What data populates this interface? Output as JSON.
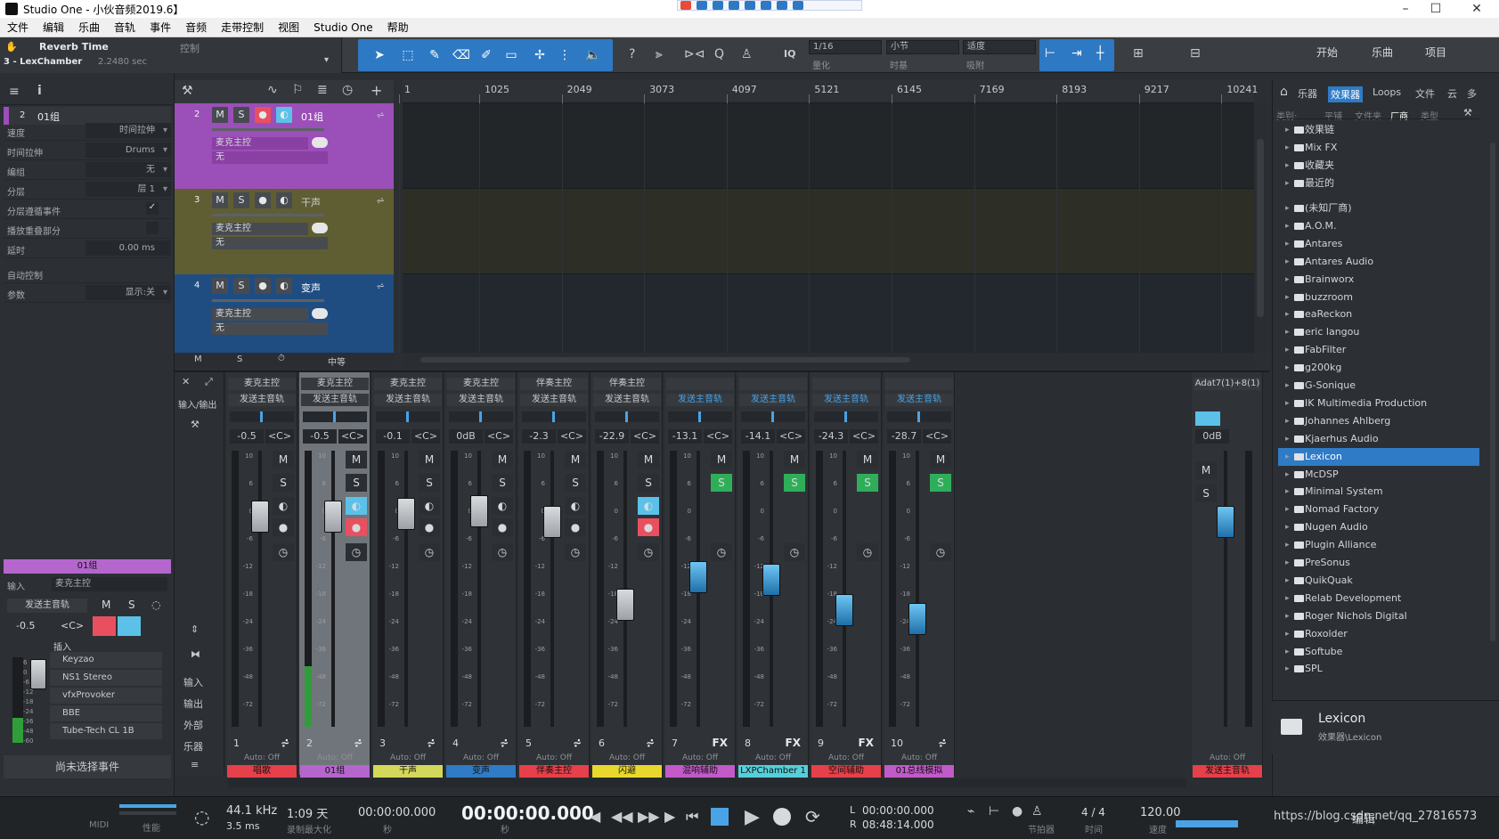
{
  "window": {
    "title": "Studio One - 小伙音频2019.6】"
  },
  "menu": [
    "文件",
    "编辑",
    "乐曲",
    "音轨",
    "事件",
    "音频",
    "走带控制",
    "视图",
    "Studio One",
    "帮助"
  ],
  "toolbar": {
    "plugin_name": "Reverb Time",
    "plugin_ctrl": "控制",
    "track_label": "3 - LexChamber",
    "plugin_value": "2.2480 sec",
    "quantize": {
      "value": "1/16",
      "label": "量化"
    },
    "timebase": {
      "value": "小节",
      "label": "时基"
    },
    "snap": {
      "value": "适度",
      "label": "吸附"
    },
    "iq": "IQ",
    "views": [
      "开始",
      "乐曲",
      "项目"
    ]
  },
  "inspector": {
    "track_num": "2",
    "track_name": "01组",
    "rows": [
      {
        "k": "速度",
        "v": "时间拉伸"
      },
      {
        "k": "时间拉伸",
        "v": "Drums"
      },
      {
        "k": "编组",
        "v": "无"
      },
      {
        "k": "分层",
        "v": "层 1"
      },
      {
        "k": "分层遵循事件",
        "v": "✓"
      },
      {
        "k": "播放重叠部分",
        "v": ""
      },
      {
        "k": "延时",
        "v": "0.00 ms"
      },
      {
        "k": "自动控制",
        "v": ""
      },
      {
        "k": "参数",
        "v": "显示:关"
      }
    ],
    "strip": {
      "name": "01组",
      "input_label": "输入",
      "input_value": "麦克主控",
      "send": "发送主音轨",
      "gain": "-0.5",
      "pan": "<C>",
      "insert_label": "插入",
      "inserts": [
        "Keyzao",
        "NS1 Stereo",
        "vfxProvoker",
        "BBE",
        "Tube-Tech CL 1B"
      ],
      "no_event": "尚未选择事件"
    },
    "scale": [
      "6",
      "0",
      "-6",
      "-12",
      "-18",
      "-24",
      "-36",
      "-48",
      "-60"
    ]
  },
  "tracks": [
    {
      "num": "2",
      "name": "01组",
      "color": "#9b4fb8",
      "laneColor": "#232629",
      "input": "麦克主控",
      "output": "无"
    },
    {
      "num": "3",
      "name": "干声",
      "color": "#5f5e33",
      "laneColor": "#2d2e25",
      "input": "麦克主控",
      "output": "无"
    },
    {
      "num": "4",
      "name": "变声",
      "color": "#1f4d82",
      "laneColor": "#22282e",
      "input": "麦克主控",
      "output": "无"
    }
  ],
  "track_footer": {
    "m": "M",
    "s": "S",
    "mid": "中等"
  },
  "ruler": [
    "1",
    "1025",
    "2049",
    "3073",
    "4097",
    "5121",
    "6145",
    "7169",
    "8193",
    "9217",
    "10241"
  ],
  "browser": {
    "tabs": [
      "乐器",
      "效果器",
      "Loops",
      "文件",
      "云",
      "多"
    ],
    "subtabs": [
      "类别:",
      "平铺",
      "文件夹",
      "厂商",
      "类型"
    ],
    "top_items": [
      "效果链",
      "Mix FX",
      "收藏夹",
      "最近的"
    ],
    "vendors": [
      "(未知厂商)",
      "A.O.M.",
      "Antares",
      "Antares Audio",
      "Brainworx",
      "buzzroom",
      "eaReckon",
      "eric langou",
      "FabFilter",
      "g200kg",
      "G-Sonique",
      "IK Multimedia Production",
      "Johannes Ahlberg",
      "Kjaerhus Audio",
      "Lexicon",
      "McDSP",
      "Minimal System",
      "Nomad Factory",
      "Nugen Audio",
      "Plugin Alliance",
      "PreSonus",
      "QuikQuak",
      "Relab Development",
      "Roger Nichols Digital",
      "Roxolder",
      "Softube",
      "SPL"
    ],
    "selected": "Lexicon",
    "footer_title": "Lexicon",
    "footer_path": "效果器\\Lexicon"
  },
  "mixer": {
    "side": [
      "输入/输出",
      "输入",
      "输出",
      "外部",
      "乐器"
    ],
    "scale": [
      "10",
      "6",
      "0",
      "-6",
      "-12",
      "-18",
      "-24",
      "-36",
      "-48",
      "-72"
    ],
    "channels": [
      {
        "num": "1",
        "top": "麦克主控",
        "send": "发送主音轨",
        "gain": "-0.5",
        "pan": "<C>",
        "name": "唱歌",
        "labelColor": "#e6404a",
        "fader": 0.18,
        "auto": "Auto: Off",
        "fx": ""
      },
      {
        "num": "2",
        "top": "麦克主控",
        "send": "发送主音轨",
        "gain": "-0.5",
        "pan": "<C>",
        "name": "01组",
        "labelColor": "#b466cc",
        "fader": 0.18,
        "auto": "Auto: Off",
        "fx": "",
        "sel": true
      },
      {
        "num": "3",
        "top": "麦克主控",
        "send": "发送主音轨",
        "gain": "-0.1",
        "pan": "<C>",
        "name": "干声",
        "labelColor": "#d4d85a",
        "fader": 0.17,
        "auto": "Auto: Off",
        "fx": ""
      },
      {
        "num": "4",
        "top": "麦克主控",
        "send": "发送主音轨",
        "gain": "0dB",
        "pan": "<C>",
        "name": "变声",
        "labelColor": "#2f7bc6",
        "fader": 0.16,
        "auto": "Auto: Off",
        "fx": ""
      },
      {
        "num": "5",
        "top": "伴奏主控",
        "send": "发送主音轨",
        "gain": "-2.3",
        "pan": "<C>",
        "name": "伴奏主控",
        "labelColor": "#e6404a",
        "fader": 0.2,
        "auto": "Auto: Off",
        "fx": ""
      },
      {
        "num": "6",
        "top": "伴奏主控",
        "send": "发送主音轨",
        "gain": "-22.9",
        "pan": "<C>",
        "name": "闪避",
        "labelColor": "#e8d82e",
        "fader": 0.5,
        "auto": "Auto: Off",
        "fx": ""
      },
      {
        "num": "7",
        "top": "",
        "send": "发送主音轨",
        "gain": "-13.1",
        "pan": "<C>",
        "name": "混响辅助",
        "labelColor": "#c25ac9",
        "fader": 0.4,
        "auto": "Auto: Off",
        "fx": "FX",
        "blue": true
      },
      {
        "num": "8",
        "top": "",
        "send": "发送主音轨",
        "gain": "-14.1",
        "pan": "<C>",
        "name": "LXPChamber 1",
        "labelColor": "#55cfd9",
        "fader": 0.41,
        "auto": "Auto: Off",
        "fx": "FX",
        "blue": true
      },
      {
        "num": "9",
        "top": "",
        "send": "发送主音轨",
        "gain": "-24.3",
        "pan": "<C>",
        "name": "空间辅助",
        "labelColor": "#e6404a",
        "fader": 0.52,
        "auto": "Auto: Off",
        "fx": "FX",
        "blue": true
      },
      {
        "num": "10",
        "top": "",
        "send": "发送主音轨",
        "gain": "-28.7",
        "pan": "<C>",
        "name": "01总线模拟",
        "labelColor": "#c25ac9",
        "fader": 0.55,
        "auto": "Auto: Off",
        "fx": "",
        "blue": true
      }
    ],
    "main": {
      "top": "Adat7(1)+8(1)",
      "gain": "0dB",
      "name": "发送主音轨",
      "labelColor": "#e6404a",
      "auto": "Auto: Off"
    }
  },
  "transport": {
    "midi": "MIDI",
    "perf": "性能",
    "sample_rate": "44.1 kHz",
    "latency": "3.5 ms",
    "rec_time": "1:09 天",
    "rec_max": "录制最大化",
    "pos_small": "00:00:00.000",
    "pos_small_label": "秒",
    "pos_main": "00:00:00.000",
    "pos_main_label": "秒",
    "loop_l": "00:00:00.000",
    "loop_r": "08:48:14.000",
    "l": "L",
    "r": "R",
    "metronome": "节拍器",
    "sig": "4 / 4",
    "sig_label": "时间",
    "tempo": "120.00",
    "tempo_label": "速度",
    "edit": "编辑",
    "watermark": "https://blog.csdn.net/qq_27816573"
  }
}
